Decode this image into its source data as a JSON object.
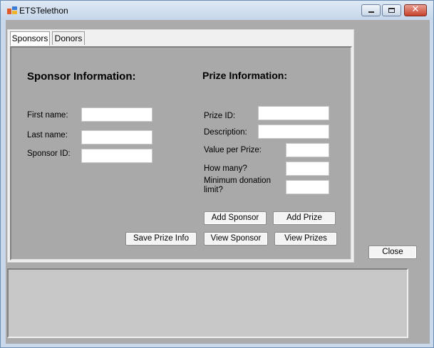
{
  "window": {
    "title": "ETSTelethon",
    "close_glyph": "✕"
  },
  "tabs": [
    {
      "label": "Sponsors"
    },
    {
      "label": "Donors"
    }
  ],
  "sponsor": {
    "heading": "Sponsor Information:",
    "first_name_label": "First name:",
    "last_name_label": "Last name:",
    "sponsor_id_label": "Sponsor ID:",
    "first_name_value": "",
    "last_name_value": "",
    "sponsor_id_value": ""
  },
  "prize": {
    "heading": "Prize Information:",
    "prize_id_label": "Prize ID:",
    "description_label": "Description:",
    "value_label": "Value per Prize:",
    "how_many_label": "How many?",
    "min_donation_label": "Minimum donation limit?",
    "prize_id_value": "",
    "description_value": "",
    "value_value": "",
    "how_many_value": "",
    "min_donation_value": ""
  },
  "buttons": {
    "add_sponsor": "Add Sponsor",
    "add_prize": "Add Prize",
    "save_prize_info": "Save Prize Info",
    "view_sponsor": "View Sponsor",
    "view_prizes": "View Prizes",
    "close": "Close"
  }
}
